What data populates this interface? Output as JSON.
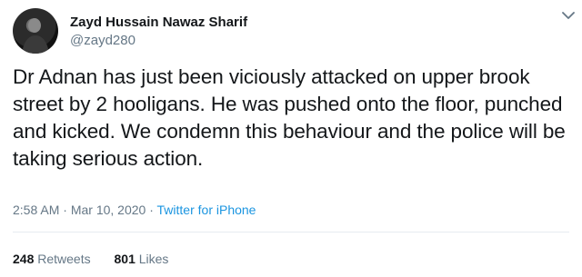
{
  "user": {
    "display_name": "Zayd Hussain Nawaz Sharif",
    "handle": "@zayd280",
    "avatar_icon": "user-avatar"
  },
  "tweet": {
    "text": "Dr Adnan has just been viciously attacked on upper brook street by 2 hooligans. He was pushed onto the floor, punched and kicked. We condemn this behaviour and the police will be taking serious action.",
    "time": "2:58 AM",
    "separator": "·",
    "date": "Mar 10, 2020",
    "source": "Twitter for iPhone"
  },
  "stats": {
    "retweets_count": "248",
    "retweets_label": "Retweets",
    "likes_count": "801",
    "likes_label": "Likes"
  },
  "colors": {
    "text": "#14171a",
    "secondary": "#657786",
    "link": "#1b95e0",
    "divider": "#e6ecf0"
  },
  "icons": {
    "menu": "chevron-down-icon"
  }
}
